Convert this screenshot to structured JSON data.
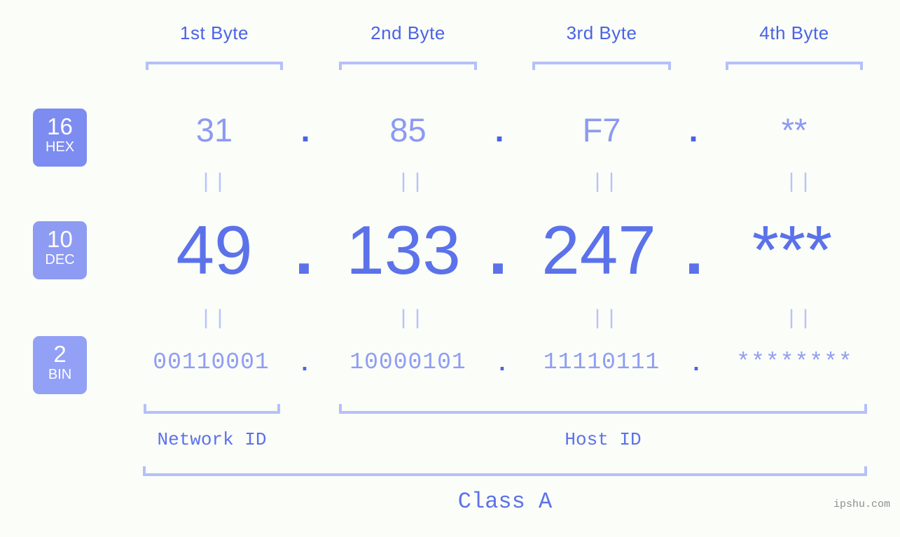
{
  "background_color": "#fbfdf8",
  "accent_color": "#5b72ea",
  "light_accent_color": "#b5c0fa",
  "badge_color": "#7d8cf0",
  "byte_headers": [
    {
      "label": "1st Byte"
    },
    {
      "label": "2nd Byte"
    },
    {
      "label": "3rd Byte"
    },
    {
      "label": "4th Byte"
    }
  ],
  "rows": {
    "hex": {
      "radix": "16",
      "name": "HEX",
      "values": [
        "31",
        "85",
        "F7",
        "**"
      ],
      "separator": "."
    },
    "dec": {
      "radix": "10",
      "name": "DEC",
      "values": [
        "49",
        "133",
        "247",
        "***"
      ],
      "separator": "."
    },
    "bin": {
      "radix": "2",
      "name": "BIN",
      "values": [
        "00110001",
        "10000101",
        "11110111",
        "********"
      ],
      "separator": "."
    }
  },
  "equals_marks": [
    "||",
    "||",
    "||",
    "||",
    "||",
    "||",
    "||",
    "||"
  ],
  "id_sections": {
    "network_id": "Network ID",
    "host_id": "Host ID"
  },
  "class_label": "Class A",
  "watermark": "ipshu.com"
}
